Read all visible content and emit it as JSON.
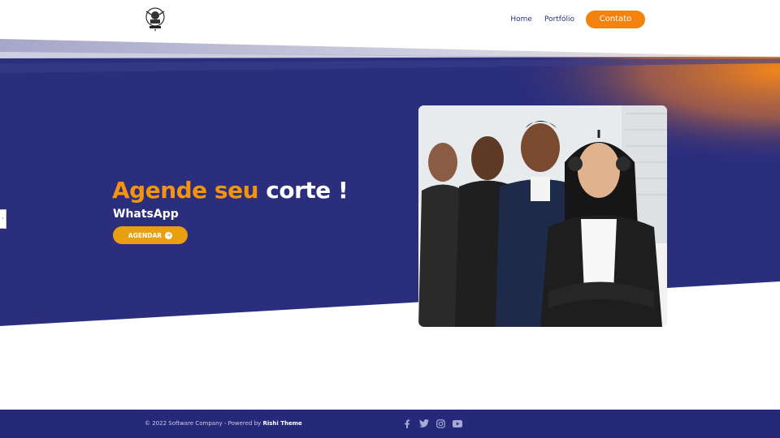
{
  "header": {
    "nav": [
      {
        "label": "Home"
      },
      {
        "label": "Portfólio"
      }
    ],
    "cta_label": "Contato",
    "logo_icon": "barber-logo-icon"
  },
  "hero": {
    "title_orange": "Agende seu",
    "title_white": "corte !",
    "subtitle": "WhatsApp",
    "button_label": "AGENDAR",
    "button_icon": "arrow-circle-right-icon",
    "photo_alt": "team-with-headsets-photo"
  },
  "side_tab": {
    "icon": "chevron-right-icon",
    "glyph": "›"
  },
  "footer": {
    "copyright_prefix": "© 2022 Software Company - Powered by",
    "copyright_brand": "Rishi Theme",
    "social": [
      "facebook-icon",
      "twitter-icon",
      "instagram-icon",
      "youtube-icon"
    ]
  },
  "colors": {
    "navy": "#2b2e7d",
    "orange": "#f4820f",
    "gold": "#e8a010",
    "footer": "#26297a"
  }
}
